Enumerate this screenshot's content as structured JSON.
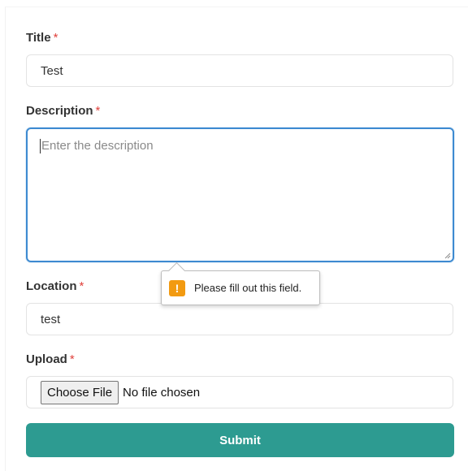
{
  "form": {
    "title": {
      "label": "Title",
      "required_mark": "*",
      "value": "Test"
    },
    "description": {
      "label": "Description",
      "required_mark": "*",
      "placeholder": "Enter the description"
    },
    "validation_tooltip": {
      "icon": "warning-icon",
      "message": "Please fill out this field."
    },
    "location": {
      "label": "Location",
      "required_mark": "*",
      "value": "test"
    },
    "upload": {
      "label": "Upload",
      "required_mark": "*",
      "button_label": "Choose File",
      "status": "No file chosen"
    },
    "submit_label": "Submit"
  },
  "colors": {
    "accent": "#2d9b91",
    "focus_border": "#3d8ad1",
    "required": "#e0413c",
    "warning": "#f29a11"
  }
}
